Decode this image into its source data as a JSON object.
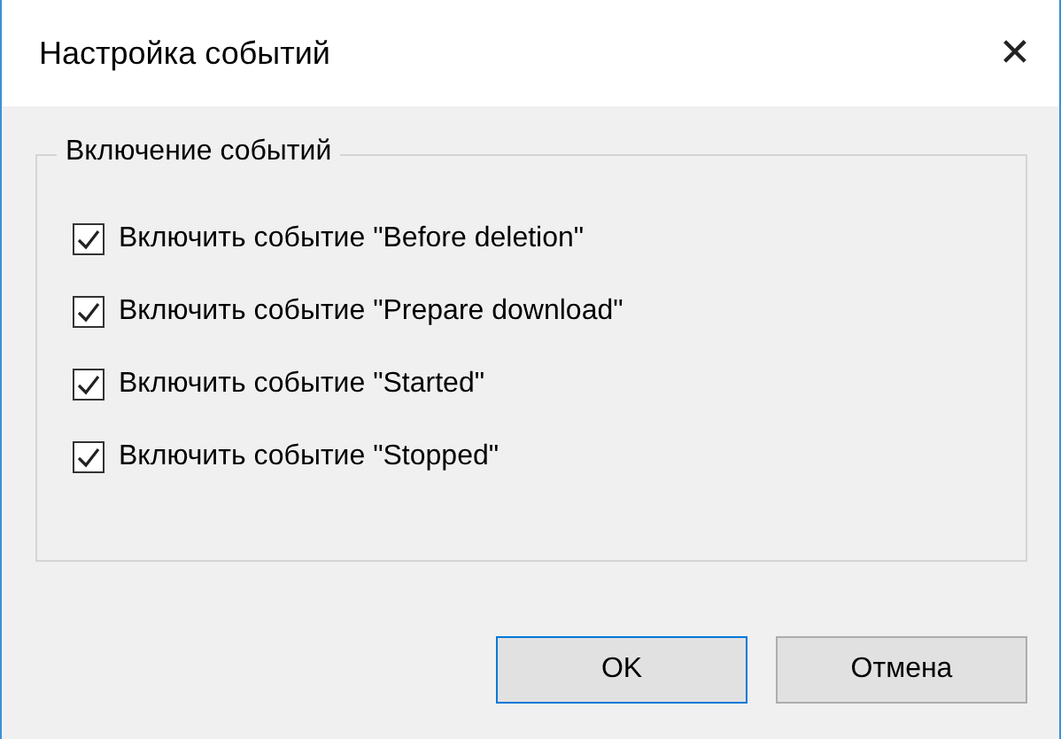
{
  "window": {
    "title": "Настройка событий",
    "close": "✕"
  },
  "group": {
    "label": "Включение событий",
    "items": [
      {
        "label": "Включить событие \"Before deletion\"",
        "checked": true
      },
      {
        "label": "Включить событие \"Prepare download\"",
        "checked": true
      },
      {
        "label": "Включить событие \"Started\"",
        "checked": true
      },
      {
        "label": "Включить событие \"Stopped\"",
        "checked": true
      }
    ]
  },
  "buttons": [
    {
      "label": "OK",
      "default": true
    },
    {
      "label": "Отмена",
      "default": false
    }
  ]
}
